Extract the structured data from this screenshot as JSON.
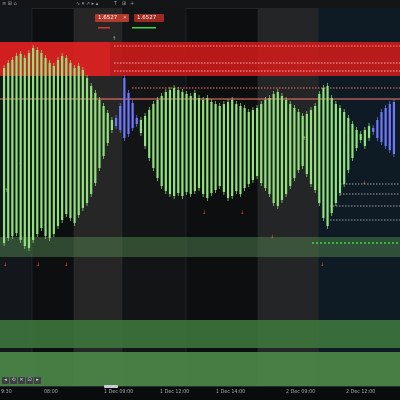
{
  "toolbar": {
    "items": [
      "≡ ⊞ ⌂",
      "∿ ▾ ↗ ▸ ▴",
      "T",
      "⊞",
      "+"
    ]
  },
  "flags": {
    "a": "1.6527",
    "b": "1.6527",
    "x": "✕"
  },
  "time_axis": {
    "labels": [
      "9:30",
      "08:00",
      "1 Dec 09:00",
      "1 Dec 12:00",
      "1 Dec 14:00",
      "2 Dec 09:00",
      "2 Dec 12:00"
    ]
  },
  "nav": {
    "buttons": [
      "◂",
      "⟲",
      "✕",
      "⊡",
      "▸"
    ]
  },
  "colors": {
    "bull": "#8fe37a",
    "bear": "#6d78ff",
    "red_zone": "#e01f1f",
    "green_zone": "#3c6a3a",
    "dotted_green": "#3bd83b",
    "dotted_red": "#ff5a4f",
    "price_line": "#ff7a6a"
  },
  "candles": {
    "series": [
      [
        60,
        235
      ],
      [
        55,
        230
      ],
      [
        52,
        228
      ],
      [
        48,
        225
      ],
      [
        46,
        232
      ],
      [
        50,
        238
      ],
      [
        45,
        240
      ],
      [
        40,
        232
      ],
      [
        42,
        226
      ],
      [
        45,
        220
      ],
      [
        50,
        228
      ],
      [
        55,
        230
      ],
      [
        58,
        226
      ],
      [
        52,
        218
      ],
      [
        48,
        212
      ],
      [
        50,
        206
      ],
      [
        55,
        210
      ],
      [
        60,
        215
      ],
      [
        58,
        207
      ],
      [
        62,
        200
      ],
      [
        70,
        195
      ],
      [
        78,
        186
      ],
      [
        85,
        175
      ],
      [
        92,
        160
      ],
      [
        98,
        148
      ],
      [
        105,
        135
      ],
      [
        112,
        122
      ],
      [
        118,
        110
      ],
      [
        122,
        98
      ],
      [
        130,
        70
      ],
      [
        126,
        85
      ],
      [
        120,
        95
      ],
      [
        116,
        110
      ],
      [
        112,
        125
      ],
      [
        108,
        138
      ],
      [
        102,
        150
      ],
      [
        96,
        160
      ],
      [
        92,
        170
      ],
      [
        88,
        178
      ],
      [
        84,
        183
      ],
      [
        82,
        186
      ],
      [
        80,
        188
      ],
      [
        82,
        185
      ],
      [
        84,
        188
      ],
      [
        86,
        184
      ],
      [
        88,
        186
      ],
      [
        85,
        183
      ],
      [
        90,
        180
      ],
      [
        92,
        186
      ],
      [
        90,
        190
      ],
      [
        94,
        185
      ],
      [
        96,
        182
      ],
      [
        98,
        178
      ],
      [
        96,
        184
      ],
      [
        94,
        190
      ],
      [
        92,
        188
      ],
      [
        96,
        183
      ],
      [
        98,
        186
      ],
      [
        100,
        180
      ],
      [
        104,
        176
      ],
      [
        102,
        172
      ],
      [
        100,
        168
      ],
      [
        96,
        175
      ],
      [
        92,
        180
      ],
      [
        90,
        186
      ],
      [
        86,
        195
      ],
      [
        84,
        198
      ],
      [
        88,
        192
      ],
      [
        92,
        186
      ],
      [
        96,
        178
      ],
      [
        100,
        170
      ],
      [
        104,
        162
      ],
      [
        108,
        158
      ],
      [
        106,
        166
      ],
      [
        102,
        176
      ],
      [
        98,
        182
      ],
      [
        86,
        195
      ],
      [
        80,
        210
      ],
      [
        78,
        218
      ],
      [
        90,
        205
      ],
      [
        96,
        195
      ],
      [
        100,
        185
      ],
      [
        104,
        176
      ],
      [
        110,
        162
      ],
      [
        116,
        150
      ],
      [
        122,
        140
      ],
      [
        126,
        132
      ],
      [
        122,
        138
      ],
      [
        118,
        130
      ],
      [
        124,
        120
      ],
      [
        130,
        112
      ],
      [
        134,
        104
      ],
      [
        138,
        100
      ],
      [
        142,
        96
      ],
      [
        146,
        94
      ]
    ]
  }
}
